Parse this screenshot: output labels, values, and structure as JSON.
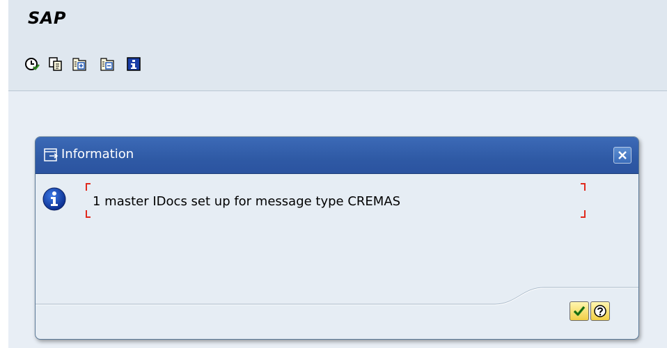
{
  "app": {
    "title": "SAP"
  },
  "toolbar": {
    "buttons": [
      {
        "icon": "clock-execute-icon",
        "tooltip": "Execute"
      },
      {
        "icon": "copy-document-icon",
        "tooltip": "Copy"
      },
      {
        "icon": "expand-all-icon",
        "tooltip": "Expand"
      },
      {
        "icon": "collapse-all-icon",
        "tooltip": "Collapse"
      },
      {
        "icon": "information-icon",
        "tooltip": "Information"
      }
    ]
  },
  "dialog": {
    "title": "Information",
    "message": "1 master IDocs set up for message type CREMAS",
    "buttons": {
      "ok_icon": "checkmark-icon",
      "help_icon": "help-icon"
    }
  },
  "colors": {
    "header_blue": "#2f5aa5",
    "background": "#e8eef5",
    "bracket_red": "#e0291c",
    "button_yellow": "#f1cf45"
  }
}
